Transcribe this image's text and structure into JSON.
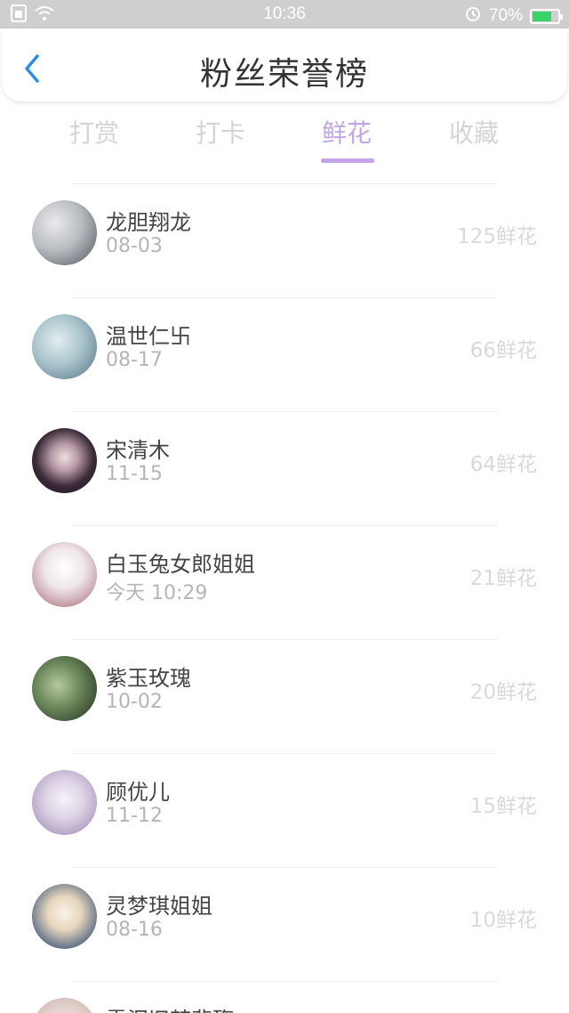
{
  "status_bar": {
    "time": "10:36",
    "battery": "70%",
    "battery_level": 0.7,
    "icons": [
      "sim-icon",
      "wifi-icon",
      "alarm-icon",
      "battery-charging-icon"
    ]
  },
  "header": {
    "title": "粉丝荣誉榜",
    "back_icon": "chevron-left-icon",
    "accent_color": "#2e8de0"
  },
  "tabs": [
    {
      "label": "打赏",
      "active": false
    },
    {
      "label": "打卡",
      "active": false
    },
    {
      "label": "鲜花",
      "active": true
    },
    {
      "label": "收藏",
      "active": false
    }
  ],
  "active_tab_color": "#c3a4e6",
  "fans": [
    {
      "name": "龙胆翔龙",
      "date": "08-03",
      "count": "125鲜花"
    },
    {
      "name": "温世仁卐",
      "date": "08-17",
      "count": "66鲜花"
    },
    {
      "name": "宋清木",
      "date": "11-15",
      "count": "64鲜花"
    },
    {
      "name": "白玉兔女郎姐姐",
      "date": "今天 10:29",
      "count": "21鲜花"
    },
    {
      "name": "紫玉玫瑰",
      "date": "10-02",
      "count": "20鲜花"
    },
    {
      "name": "顾优儿",
      "date": "11-12",
      "count": "15鲜花"
    },
    {
      "name": "灵梦琪姐姐",
      "date": "08-16",
      "count": "10鲜花"
    },
    {
      "name": "雪泪旧梦悲殇",
      "date": "",
      "count": ""
    }
  ]
}
